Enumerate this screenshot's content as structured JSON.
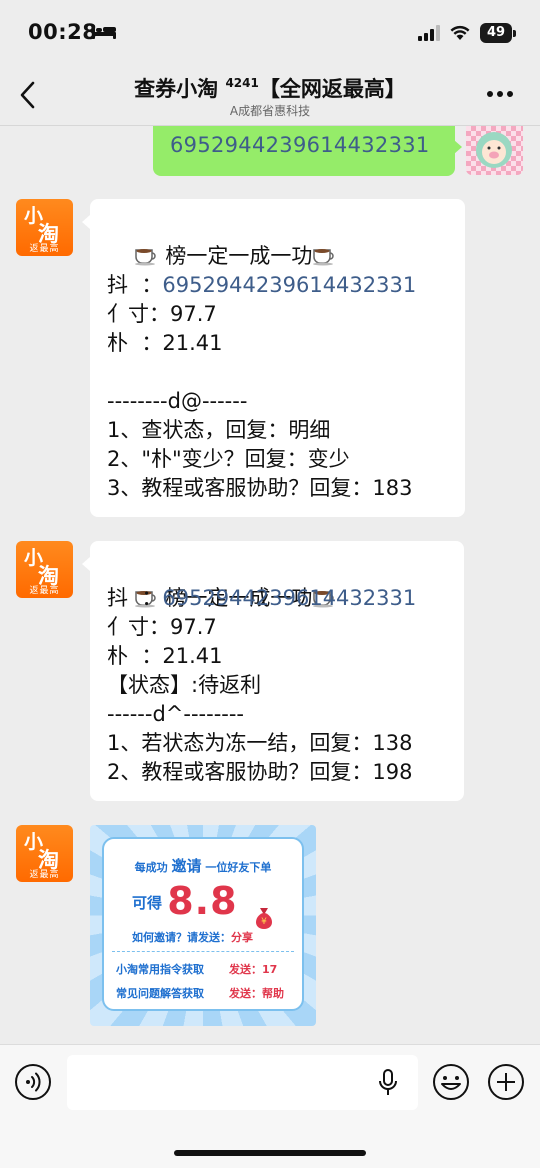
{
  "status_bar": {
    "time": "00:28",
    "battery": "49",
    "icons": [
      "bed-icon",
      "signal-icon",
      "wifi-icon",
      "battery-icon"
    ]
  },
  "header": {
    "title_main": "查券小淘",
    "title_sup": "4241",
    "title_suffix": "【全网返最高】",
    "subtitle": "A成都省惠科技",
    "icons": [
      "back-icon",
      "more-icon"
    ]
  },
  "messages": {
    "sent": {
      "text": "6952944239614432331"
    },
    "msg1": {
      "heading": " 榜一定一成一功",
      "lines": [
        {
          "label": "抖  ：",
          "value": "6952944239614432331"
        },
        {
          "label": "亻寸：",
          "value": "97.7"
        },
        {
          "label": "朴  ：",
          "value": "21.41"
        }
      ],
      "divider": "--------d@------",
      "options": [
        "1、查状态，回复：明细",
        "2、\"朴\"变少？回复：变少",
        "3、教程或客服协助？回复：183"
      ]
    },
    "msg2": {
      "heading": " 榜一定一成一功",
      "lines": [
        {
          "label": "抖  ：",
          "value": "6952944239614432331"
        },
        {
          "label": "亻寸：",
          "value": "97.7"
        },
        {
          "label": "朴  ：",
          "value": "21.41"
        }
      ],
      "status": "【状态】:待返利",
      "divider": "------d^--------",
      "options": [
        "1、若状态为冻一结，回复：138",
        "2、教程或客服协助？回复：198"
      ]
    },
    "card": {
      "l1_a": "每成功 ",
      "l1_strong": "邀请",
      "l1_b": " 一位好友下单",
      "l2_label": "可得 ",
      "l2_amount": "8.8",
      "l3_a": "如何邀请？请发送：",
      "l3_b": "分享",
      "row1_label": "小淘常用指令获取",
      "row1_value": "发送：17",
      "row2_label": "常见问题解答获取",
      "row2_value": "发送：帮助"
    },
    "bot_avatar": {
      "line1": "小",
      "line2": "淘",
      "line3": "返最高"
    }
  },
  "input_bar": {
    "placeholder": "",
    "icons": [
      "voice-icon",
      "mic-icon",
      "emoji-icon",
      "plus-icon"
    ]
  },
  "colors": {
    "accent_green": "#95ec69",
    "link_blue": "#3e5d8a",
    "brand_orange": "#ff6a00",
    "card_red": "#e0364b",
    "card_blue": "#1e6fcf"
  }
}
